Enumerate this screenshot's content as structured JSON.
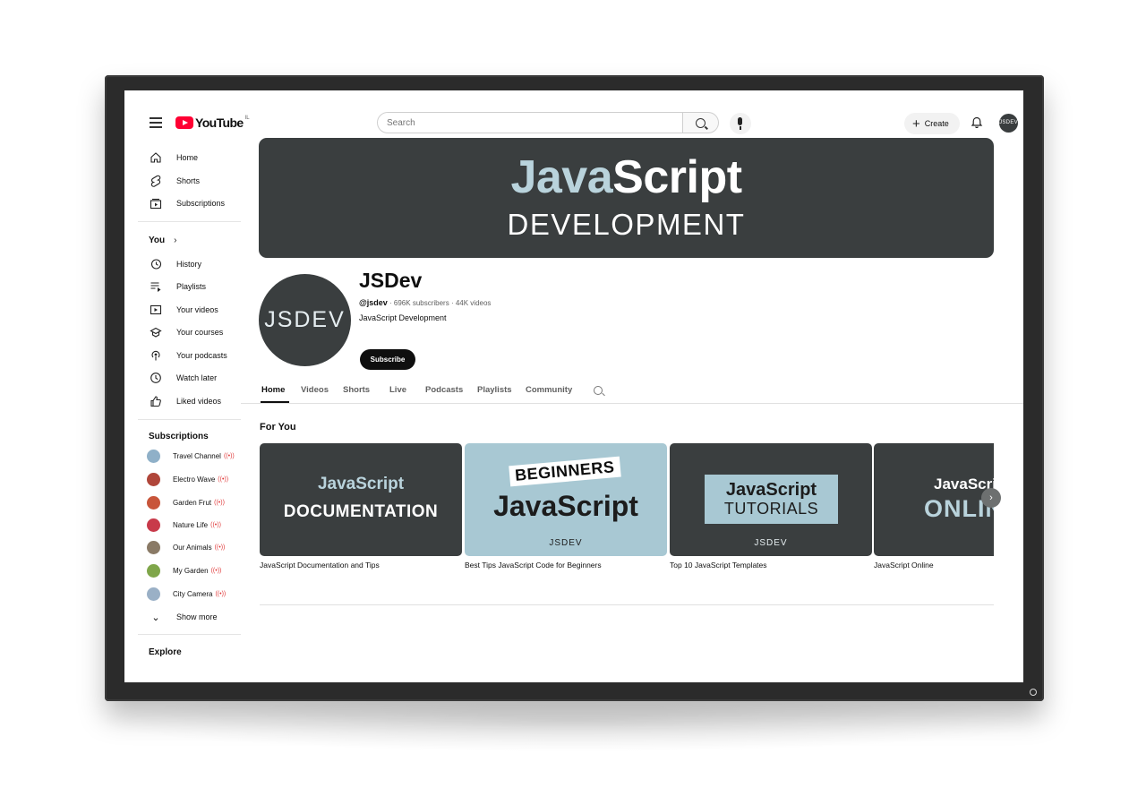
{
  "topbar": {
    "logo_text": "YouTube",
    "logo_country": "IL",
    "search_placeholder": "Search",
    "create_label": "Create",
    "avatar_text": "JSDEV"
  },
  "sidebar": {
    "main": [
      "Home",
      "Shorts",
      "Subscriptions"
    ],
    "you_title": "You",
    "you_items": [
      "History",
      "Playlists",
      "Your videos",
      "Your courses",
      "Your podcasts",
      "Watch later",
      "Liked videos"
    ],
    "subs_title": "Subscriptions",
    "subscriptions": [
      "Travel Channel",
      "Electro Wave",
      "Garden Frut",
      "Nature Life",
      "Our Animals",
      "My Garden",
      "City Camera"
    ],
    "show_more": "Show more",
    "explore_title": "Explore"
  },
  "banner": {
    "title_accent": "Java",
    "title_rest": "Script",
    "subtitle": "DEVELOPMENT"
  },
  "channel": {
    "avatar_text": "JSDEV",
    "name": "JSDev",
    "handle": "@jsdev",
    "subscribers": "696K subscribers",
    "videos": "44K videos",
    "description": "JavaScript Development",
    "subscribe_label": "Subscribe"
  },
  "tabs": [
    "Home",
    "Videos",
    "Shorts",
    "Live",
    "Podcasts",
    "Playlists",
    "Community"
  ],
  "section_title": "For You",
  "cards": [
    {
      "line1": "JavaScript",
      "line2": "DOCUMENTATION",
      "title": "JavaScript Documentation and Tips"
    },
    {
      "badge": "BEGINNERS",
      "main": "JavaScript",
      "logo": "JSDEV",
      "title": "Best Tips JavaScript Code for Beginners"
    },
    {
      "line1": "JavaScript",
      "line2": "TUTORIALS",
      "logo": "JSDEV",
      "title": "Top 10 JavaScript Templates"
    },
    {
      "line1": "JavaScript",
      "line2": "ONLINE",
      "title": "JavaScript Online"
    }
  ],
  "colors": {
    "accent_red": "#ff0033",
    "banner_bg": "#3a3e3f",
    "light_blue": "#b9d3dc",
    "live_red": "#e03b3b"
  },
  "icons": {
    "sidebar": [
      "home-icon",
      "shorts-icon",
      "subscriptions-icon",
      "history-icon",
      "playlists-icon",
      "your-videos-icon",
      "courses-icon",
      "podcasts-icon",
      "watch-later-icon",
      "liked-icon"
    ]
  }
}
